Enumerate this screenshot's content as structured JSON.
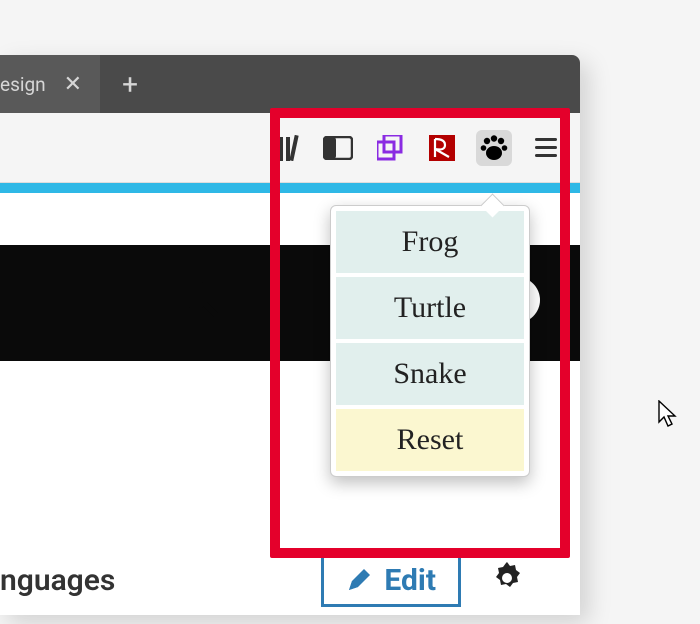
{
  "tab": {
    "label": "esign",
    "close_glyph": "✕"
  },
  "toolbar": {
    "new_tab_glyph": "+"
  },
  "popup": {
    "items": [
      "Frog",
      "Turtle",
      "Snake"
    ],
    "reset_label": "Reset"
  },
  "page": {
    "lang_fragment": "nguages",
    "edit_label": "Edit"
  },
  "colors": {
    "highlight": "#e4002b",
    "accent": "#2fb8e6",
    "edit_border": "#2e7bb3"
  }
}
